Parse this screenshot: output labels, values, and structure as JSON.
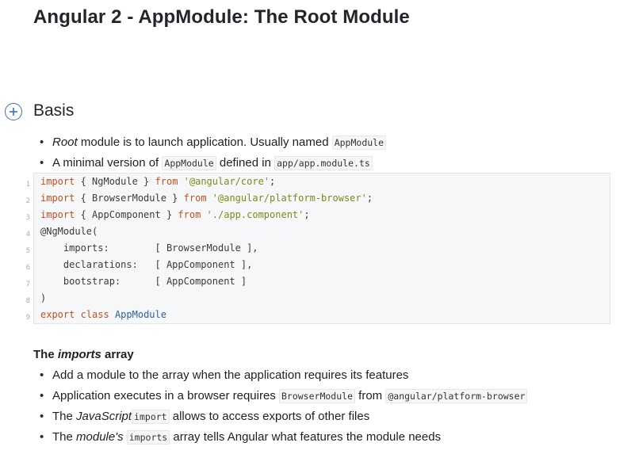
{
  "page": {
    "title": "Angular 2 - AppModule: The Root Module"
  },
  "basis": {
    "heading": "Basis",
    "expand_icon": "plus-circle-icon",
    "items": [
      {
        "em": "Root",
        "text": " module is to launch application. Usually named ",
        "code": "AppModule"
      },
      {
        "text1": "A minimal version of ",
        "code1": "AppModule",
        "text2": " defined in ",
        "code2": "app/app.module.ts"
      }
    ]
  },
  "code_block": {
    "line_numbers": [
      "1",
      "2",
      "3",
      "4",
      "5",
      "6",
      "7",
      "8",
      "9"
    ],
    "l1": {
      "kw1": "import",
      "mid": " { NgModule } ",
      "kw2": "from",
      "sp": " ",
      "str": "'@angular/core'",
      "end": ";"
    },
    "l2": {
      "kw1": "import",
      "mid": " { BrowserModule } ",
      "kw2": "from",
      "sp": " ",
      "str": "'@angular/platform-browser'",
      "end": ";"
    },
    "l3": {
      "kw1": "import",
      "mid": " { AppComponent } ",
      "kw2": "from",
      "sp": " ",
      "str": "'./app.component'",
      "end": ";"
    },
    "l4": "@NgModule(",
    "l5": "    imports:        [ BrowserModule ],",
    "l6": "    declarations:   [ AppComponent ],",
    "l7": "    bootstrap:      [ AppComponent ]",
    "l8": ")",
    "l9": {
      "kw1": "export",
      "sp1": " ",
      "kw2": "class",
      "sp2": " ",
      "cls": "AppModule"
    }
  },
  "imports_section": {
    "heading_prefix": "The ",
    "heading_em": "imports",
    "heading_suffix": " array",
    "items": [
      {
        "text": "Add a module to the array when the application requires its features"
      },
      {
        "text1": "Application executes in a browser requires ",
        "code1": "BrowserModule",
        "text2": " from ",
        "code2": "@angular/platform-browser"
      },
      {
        "text1": "The ",
        "em": "JavaScript",
        "code": "import",
        "text2": " allows to access exports of other files"
      },
      {
        "text1": "The ",
        "em": "module's",
        "code": "imports",
        "text2": " array tells Angular what features the module needs"
      }
    ]
  }
}
